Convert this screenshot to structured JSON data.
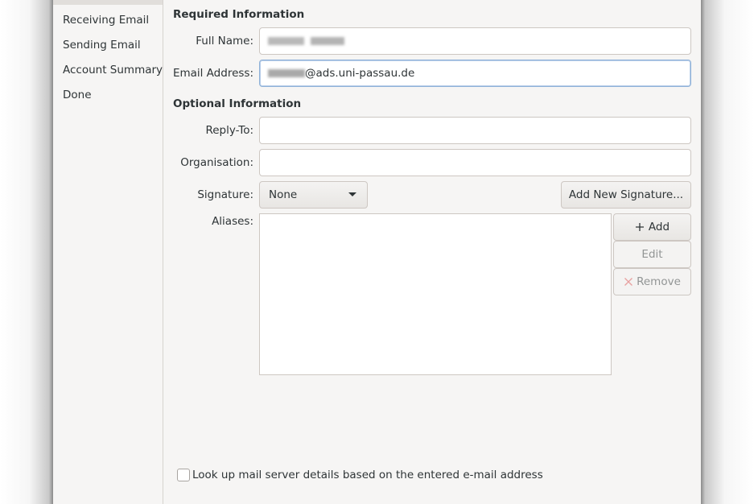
{
  "sidebar": {
    "items": [
      {
        "label": "Receiving Email"
      },
      {
        "label": "Sending Email"
      },
      {
        "label": "Account Summary"
      },
      {
        "label": "Done"
      }
    ]
  },
  "required": {
    "heading": "Required Information",
    "full_name_label": "Full Name:",
    "email_label": "Email Address:",
    "email_value_visible": "@ads.uni-passau.de"
  },
  "optional": {
    "heading": "Optional Information",
    "reply_to_label": "Reply-To:",
    "organisation_label": "Organisation:",
    "signature_label": "Signature:",
    "signature_value": "None",
    "add_signature_label": "Add New Signature...",
    "aliases_label": "Aliases:",
    "add_label": "Add",
    "edit_label": "Edit",
    "remove_label": "Remove"
  },
  "lookup": {
    "label": "Look up mail server details based on the entered e-mail address",
    "checked": false
  },
  "colors": {
    "focus_border": "#8fb1d8",
    "remove_icon": "#e8a0a0"
  }
}
